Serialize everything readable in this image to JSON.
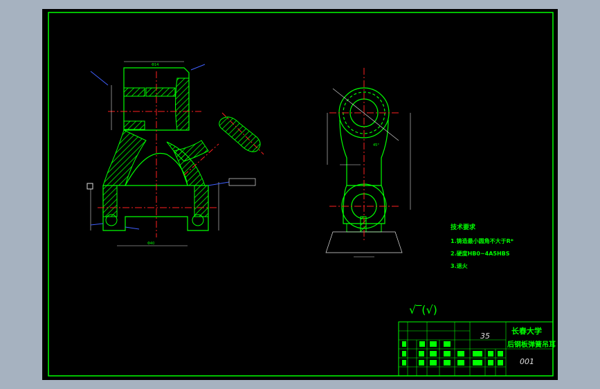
{
  "drawing": {
    "tech_req_title": "技术要求",
    "tech_req_items": [
      "1.铸造最小圆角不大于R*",
      "2.硬度HB0~4A5HBS",
      "3.退火"
    ],
    "roughness_symbol": "√‾(√)",
    "dim_labels": {
      "top_width": "Φ14",
      "bottom_width": "Φ40",
      "angle": "45°"
    }
  },
  "title_block": {
    "school": "长春大学",
    "part_name": "后钢板弹簧吊耳",
    "material": "35",
    "drawing_no": "001"
  },
  "colors": {
    "background": "#000000",
    "frame": "#00ff00",
    "outline": "#00ff00",
    "centerline": "#ff2020",
    "hatch": "#00ff00",
    "dim": "#e0e0e0",
    "dim_text": "#00ffff",
    "leader": "#4060ff",
    "window": "#a6b2c0"
  }
}
